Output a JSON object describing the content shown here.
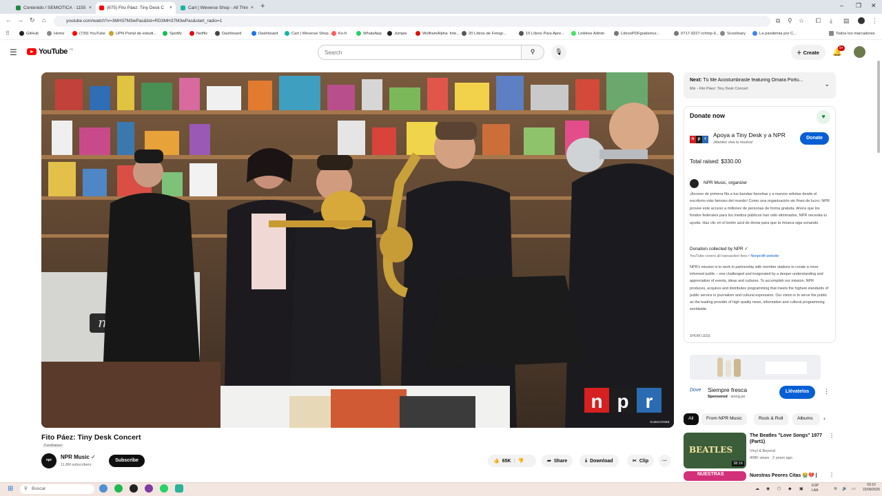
{
  "browser": {
    "tabs": [
      {
        "title": "Contenido / SEMIOTICA · 1155",
        "active": false,
        "color": "#1e8e3e"
      },
      {
        "title": "(675) Fito Páez: Tiny Desk C",
        "active": true,
        "color": "#ff0000"
      },
      {
        "title": "Cart | Weverse Shop - All Thing",
        "active": false,
        "color": "#12b5a5"
      }
    ],
    "new_tab": "+",
    "url": "youtube.com/watch?v=3MH37M3wPas&list=RD3MH37M3wPas&start_radio=1",
    "bookmarks": [
      {
        "label": "GitHub",
        "color": "#222"
      },
      {
        "label": "Home",
        "color": "#888"
      },
      {
        "label": "(739) YouTube",
        "color": "#f00"
      },
      {
        "label": "UPN Portal de estudi...",
        "color": "#c9a227"
      },
      {
        "label": "Spotify",
        "color": "#1db954"
      },
      {
        "label": "Netflix",
        "color": "#e50914"
      },
      {
        "label": "Dashboard",
        "color": "#444"
      },
      {
        "label": "Dashboard",
        "color": "#1a73e8"
      },
      {
        "label": "Cart | Weverse Shop...",
        "color": "#12b5a5"
      },
      {
        "label": "Ko-fi",
        "color": "#ff5e5b"
      },
      {
        "label": "WhatsApp",
        "color": "#25d366"
      },
      {
        "label": "Jumpie",
        "color": "#222"
      },
      {
        "label": "WolframAlpha: Inte...",
        "color": "#dd1100"
      },
      {
        "label": "20 Libros de Fotogr...",
        "color": "#555"
      },
      {
        "label": "15 Libros Para Apre...",
        "color": "#555"
      },
      {
        "label": "Linktree Admin",
        "color": "#43e660"
      },
      {
        "label": "LibrosPDFgratismur...",
        "color": "#777"
      },
      {
        "label": "0717-9227-rchmp-6...",
        "color": "#777"
      },
      {
        "label": "Scoolinary",
        "color": "#888"
      },
      {
        "label": "La pandemia por C...",
        "color": "#4285f4"
      }
    ],
    "all_bookmarks": "Todos los marcadores"
  },
  "yt": {
    "logo": "YouTube",
    "country": "PE",
    "search_placeholder": "Search",
    "create": "Create",
    "notifications": "9+"
  },
  "video": {
    "title": "Fito Páez: Tiny Desk Concert",
    "fundraiser": "Fundraiser",
    "channel": "NPR Music",
    "channel_avatar": "NPR Music",
    "subscribers": "11.8M subscribers",
    "subscribe": "Subscribe",
    "likes": "65K",
    "share": "Share",
    "download": "Download",
    "clip": "Clip",
    "overlay_logo": "npr",
    "overlay_subscribe": "SUBSCRIBE"
  },
  "upnext": {
    "prefix": "Next:",
    "title": "Tú Me Acostumbraste featuring Omara Portu...",
    "subtitle": "Mix - Fito Páez: Tiny Desk Concert"
  },
  "donate": {
    "heading": "Donate now",
    "org_title": "Apoya a Tiny Desk y a NPR",
    "org_sub": "¡Mantén viva la música!",
    "button": "Donate",
    "total": "Total raised: $330.00",
    "organizer": "NPR Music, organizer",
    "description": "¡Acceso de primera fila a tus bandas favoritas y a nuevos artistas desde el escritorio más famoso del mundo! Como una organización sin fines de lucro, NPR provee este acceso a millones de personas de forma gratuita. Ahora que los fondos federales para los medios públicos han sido eliminados, NPR necesita tu ayuda. Haz clic en el botón azul de donar para que la música siga sonando.",
    "collected_by": "Donation collected by NPR",
    "fees": "YouTube covers all transaction fees",
    "nonprofit_link": "Nonprofit website",
    "mission": "NPR's mission is to work in partnership with member stations to create a more informed public – one challenged and invigorated by a deeper understanding and appreciation of events, ideas and cultures. To accomplish our mission, NPR produces, acquires and distributes programming that meets the highest standards of public service in journalism and cultural expression. Our vision is to serve the public as the leading provider of high quality news, information and cultural programming worldwide.",
    "show_less": "SHOW LESS"
  },
  "ad": {
    "brand": "Dove",
    "title": "Siempre fresca",
    "sponsored": "Sponsored",
    "domain": "wong.pe",
    "button": "Llévatelos"
  },
  "chips": [
    "All",
    "From NPR Music",
    "Rock & Roll",
    "Albums"
  ],
  "related": [
    {
      "title": "The Beatles \"Love Songs\" 1977 (Part1)",
      "channel": "Vinyl & Beyond",
      "meta": "408K views · 2 years ago",
      "duration": "38:16",
      "thumb_text": "BEATLES"
    },
    {
      "title": "Nuestras Peores Citas 😭💔 |",
      "channel": "",
      "meta": "",
      "duration": "",
      "thumb_text": "NUESTRAS"
    }
  ],
  "taskbar": {
    "search": "Buscar",
    "lang": "ESP LAA",
    "time": "03:10",
    "date": "22/09/2025"
  }
}
